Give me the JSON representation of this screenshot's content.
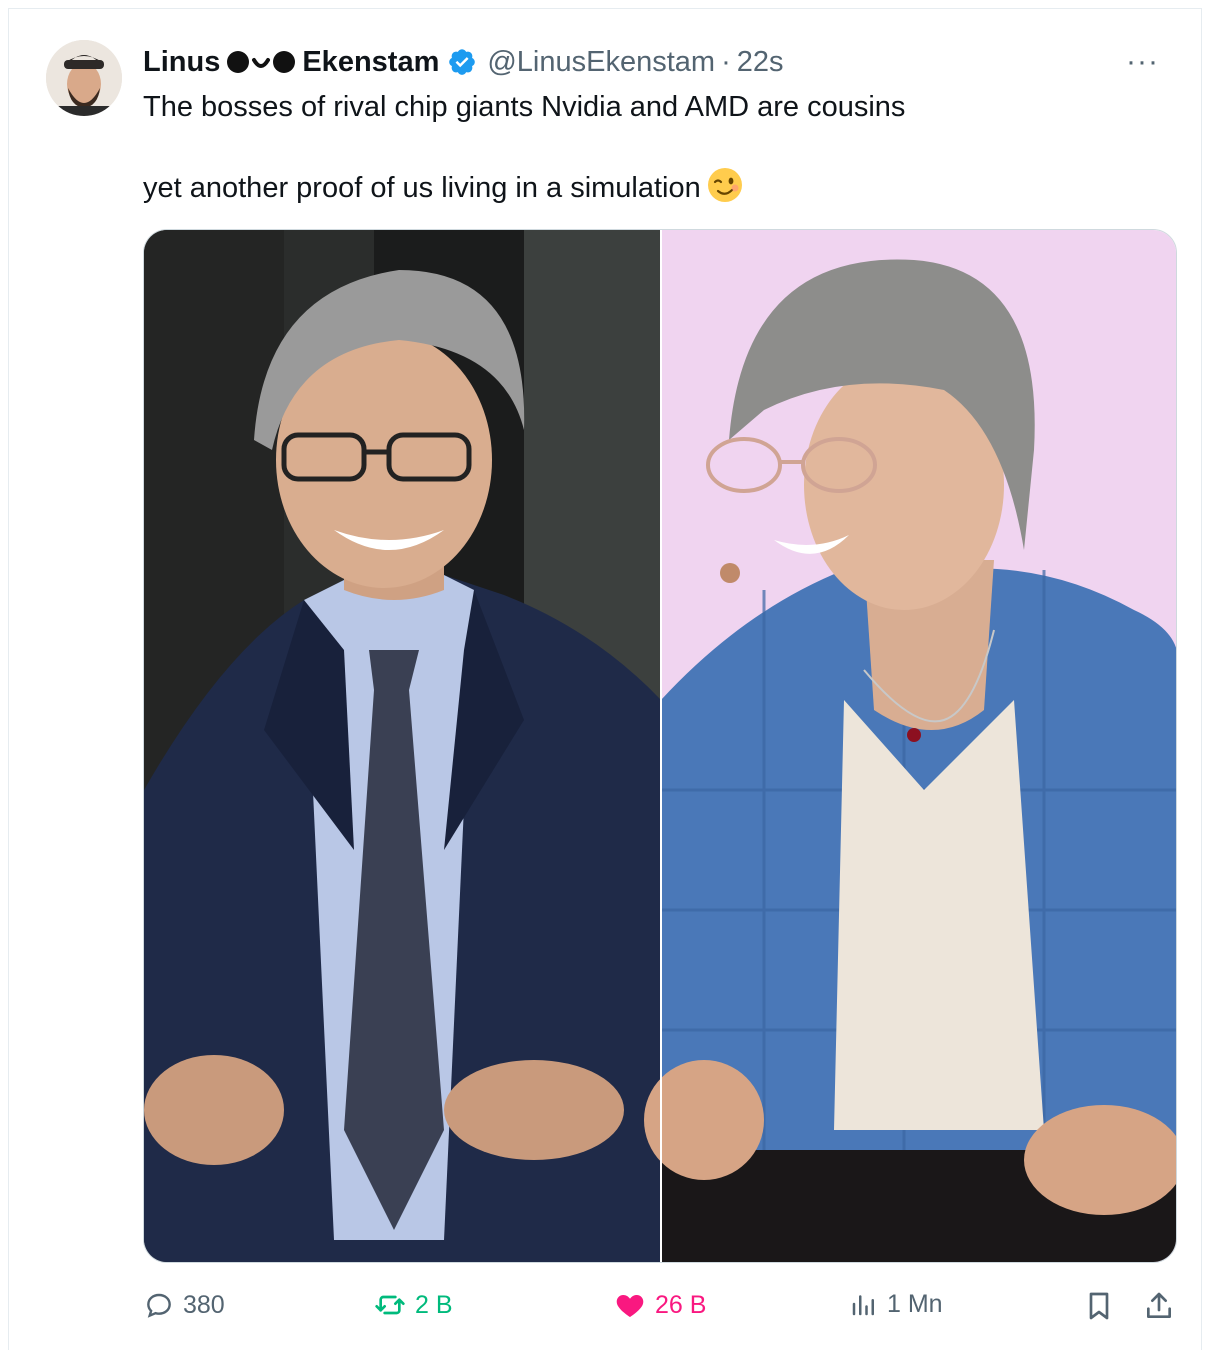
{
  "tweet": {
    "author": {
      "name_first": "Linus",
      "name_last": "Ekenstam",
      "handle": "@LinusEkenstam",
      "verified_color": "#1d9bf0"
    },
    "separator": "·",
    "time": "22s",
    "more_label": "···",
    "text_line1": "The bosses of rival chip giants Nvidia and AMD are cousins",
    "text_line2": "yet another proof of us living in a simulation",
    "emoji": "winking-face-emoji"
  },
  "actions": {
    "replies": "380",
    "retweets": "2 B",
    "likes": "26 B",
    "views": "1 Mn"
  },
  "colors": {
    "text": "#0f1419",
    "muted": "#536471",
    "retweet": "#00ba7c",
    "like": "#f91880",
    "verified": "#1d9bf0"
  }
}
